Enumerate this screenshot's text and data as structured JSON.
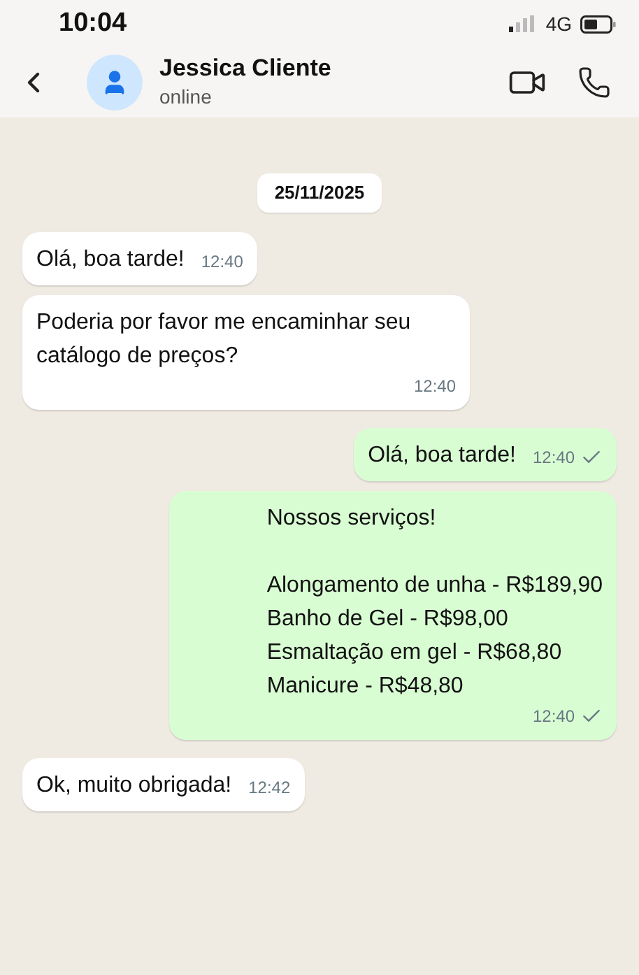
{
  "status_bar": {
    "time": "10:04",
    "network": "4G"
  },
  "header": {
    "name": "Jessica Cliente",
    "status": "online"
  },
  "date_chip": "25/11/2025",
  "messages": [
    {
      "kind": "incoming",
      "text": "Olá, boa tarde!",
      "time": "12:40"
    },
    {
      "kind": "incoming",
      "text": "Poderia por favor me encaminhar seu catálogo de preços?",
      "time": "12:40"
    },
    {
      "kind": "outgoing",
      "text": "Olá, boa tarde!",
      "time": "12:40",
      "read": false
    },
    {
      "kind": "outgoing",
      "text": "Nossos serviços!\n\nAlongamento de unha - R$189,90\nBanho de Gel - R$98,00\nEsmaltação em gel - R$68,80\nManicure - R$48,80",
      "time": "12:40",
      "read": false
    },
    {
      "kind": "incoming",
      "text": "Ok, muito obrigada!",
      "time": "12:42"
    }
  ]
}
